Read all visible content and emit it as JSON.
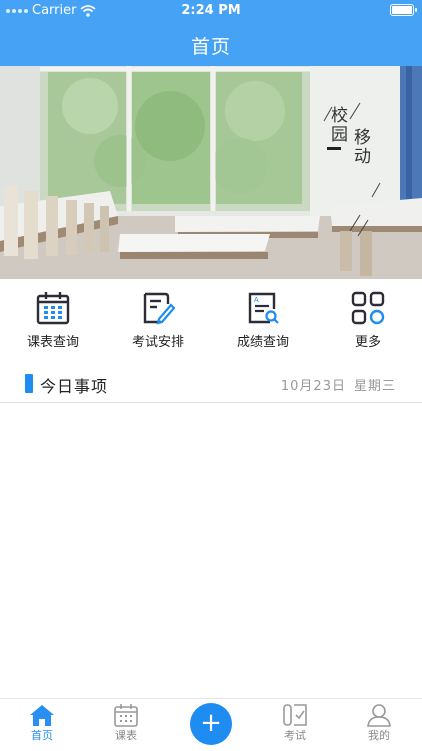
{
  "status": {
    "carrier": "Carrier",
    "time": "2:24 PM"
  },
  "header": {
    "title": "首页"
  },
  "banner": {
    "line1": "校园",
    "line2": "移动"
  },
  "quick_actions": [
    {
      "label": "课表查询",
      "icon": "calendar-icon"
    },
    {
      "label": "考试安排",
      "icon": "exam-edit-icon"
    },
    {
      "label": "成绩查询",
      "icon": "score-search-icon"
    },
    {
      "label": "更多",
      "icon": "grid-more-icon"
    }
  ],
  "today": {
    "title": "今日事项",
    "date": "10月23日",
    "weekday": "星期三"
  },
  "tabs": [
    {
      "label": "首页",
      "icon": "home-icon",
      "active": true
    },
    {
      "label": "课表",
      "icon": "calendar-icon"
    },
    {
      "label": "+",
      "icon": "plus-icon"
    },
    {
      "label": "考试",
      "icon": "exam-icon"
    },
    {
      "label": "我的",
      "icon": "user-icon"
    }
  ],
  "colors": {
    "primary": "#45a2f5",
    "accent": "#1e8cf0"
  }
}
